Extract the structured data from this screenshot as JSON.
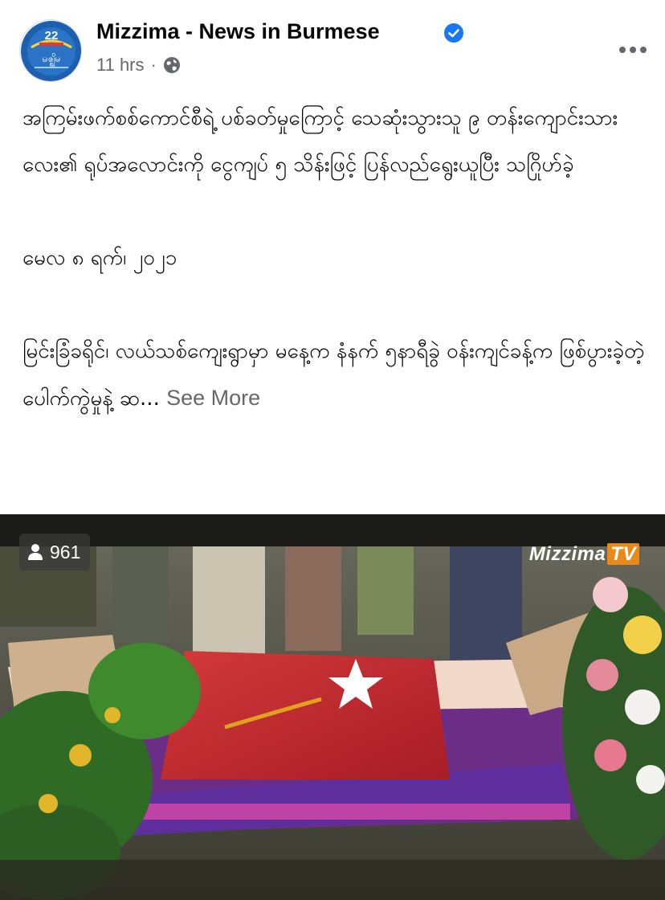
{
  "post": {
    "page_name": "Mizzima - News in Burmese",
    "time": "11 hrs",
    "privacy_icon": "globe-icon",
    "avatar_text": "မဇ္ဈိမ",
    "avatar_badge": "22",
    "paragraphs": [
      "အကြမ်းဖက်စစ်ကောင်စီရဲ့ ပစ်ခတ်မှုကြောင့် သေဆုံးသွားသူ ၉ တန်းကျောင်းသားလေး၏ ရုပ်အလောင်းကို ငွေကျပ် ၅ သိန်းဖြင့် ပြန်လည်ရွေးယူပြီး သဂြိုဟ်ခဲ့",
      "မေလ ၈ ရက်၊ ၂၀၂၁"
    ],
    "truncated_paragraph": "မြင်းခြံခရိုင်၊ လယ်သစ်ကျေးရွာမှာ မနေ့က နံနက် ၅နာရီခွဲ ဝန်းကျင်ခန့်က ဖြစ်ပွားခဲ့တဲ့ ပေါက်ကွဲမှုနဲ့ ဆ...",
    "see_more": "See More"
  },
  "media": {
    "view_count": "961",
    "watermark": "Mizzima",
    "watermark_tv": "TV",
    "colors": {
      "flag_red": "#c8282c",
      "coffin_purple": "#7a2c8c",
      "verified_blue": "#1877f2"
    }
  }
}
